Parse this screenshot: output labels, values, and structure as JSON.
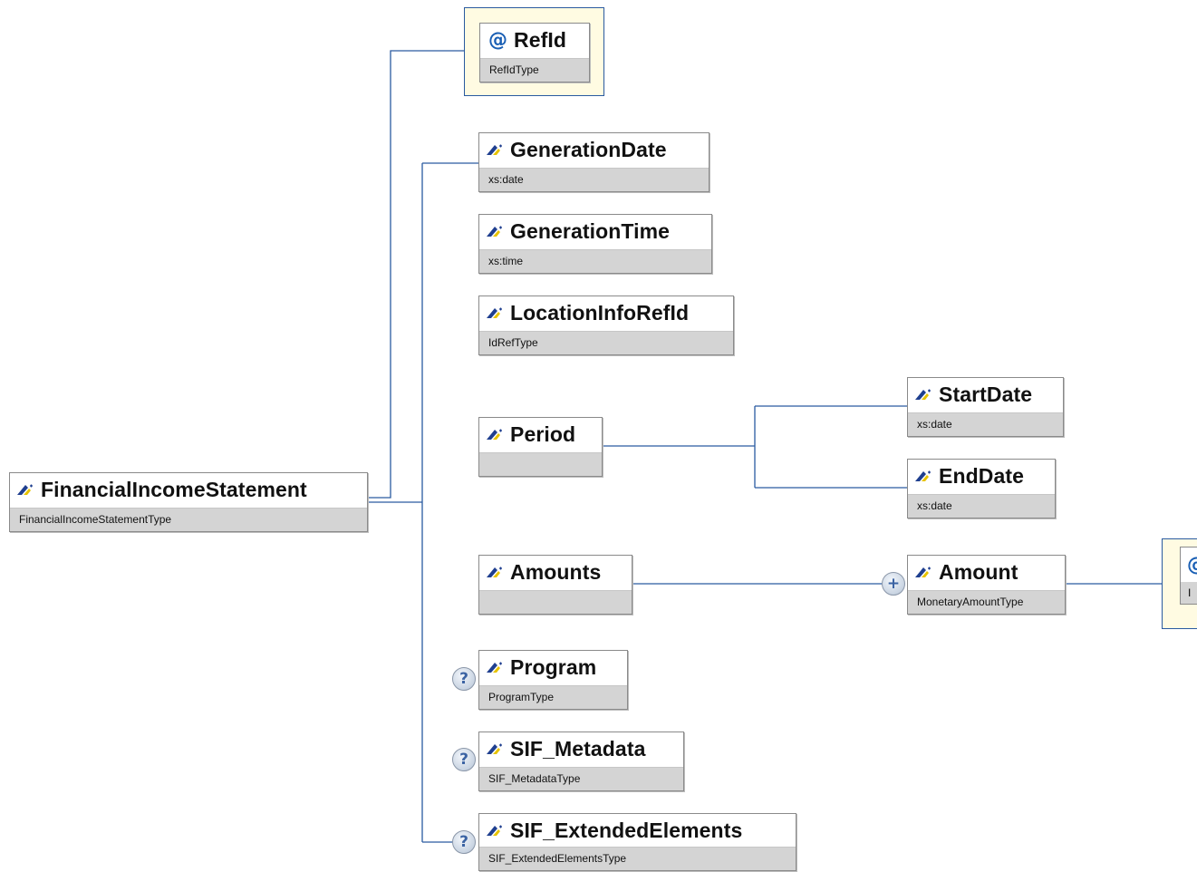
{
  "diagram": {
    "root": {
      "name": "FinancialIncomeStatement",
      "type": "FinancialIncomeStatementType"
    },
    "attribute": {
      "name": "RefId",
      "type": "RefIdType",
      "icon": "at-sign-icon"
    },
    "children": [
      {
        "name": "GenerationDate",
        "type": "xs:date"
      },
      {
        "name": "GenerationTime",
        "type": "xs:time"
      },
      {
        "name": "LocationInfoRefId",
        "type": "IdRefType"
      },
      {
        "name": "Period",
        "type": ""
      },
      {
        "name": "Amounts",
        "type": ""
      },
      {
        "name": "Program",
        "type": "ProgramType",
        "optional_marker": "?"
      },
      {
        "name": "SIF_Metadata",
        "type": "SIF_MetadataType",
        "optional_marker": "?"
      },
      {
        "name": "SIF_ExtendedElements",
        "type": "SIF_ExtendedElementsType",
        "optional_marker": "?"
      }
    ],
    "period_children": [
      {
        "name": "StartDate",
        "type": "xs:date"
      },
      {
        "name": "EndDate",
        "type": "xs:date"
      }
    ],
    "amounts_children": [
      {
        "name": "Amount",
        "type": "MonetaryAmountType",
        "repeat_marker": "+"
      }
    ],
    "clipped_attribute": {
      "icon_char": "@",
      "type_fragment": "I"
    }
  },
  "colors": {
    "connector": "#2a5aa0",
    "attribute_frame_bg": "#fffbe2",
    "type_bar": "#d4d4d4",
    "element_icon_blue": "#1f3f8f",
    "element_icon_yellow": "#e7c300"
  }
}
